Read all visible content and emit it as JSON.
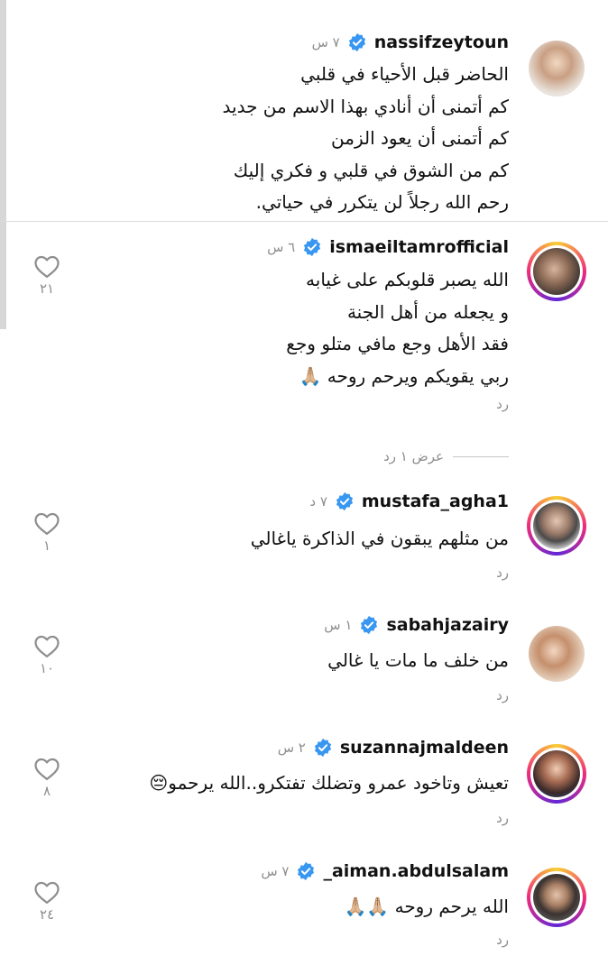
{
  "comments": [
    {
      "username": "nassifzeytoun",
      "time": "٧ س",
      "lines": [
        "الحاضر قبل الأحياء في قلبي",
        "كم أتمنى أن أنادي بهذا الاسم من جديد",
        "كم أتمنى أن يعود الزمن",
        "كم من الشوق في قلبي و فكري إليك",
        "رحم الله رجلاً لن يتكرر في حياتي."
      ],
      "likes": "",
      "reply": ""
    },
    {
      "username": "ismaeiltamrofficial",
      "time": "٦ س",
      "lines": [
        "الله يصبر قلوبكم على غيابه",
        "و يجعله من أهل الجنة",
        "فقد الأهل وجع مافي متلو وجع",
        "ربي يقويكم ويرحم روحه 🙏🏼"
      ],
      "likes": "٢١",
      "reply": "رد"
    },
    {
      "username": "mustafa_agha1",
      "time": "٧ د",
      "lines": [
        "من مثلهم يبقون في الذاكرة ياغالي"
      ],
      "likes": "١",
      "reply": "رد"
    },
    {
      "username": "sabahjazairy",
      "time": "١ س",
      "lines": [
        "من خلف ما مات يا غالي"
      ],
      "likes": "١٠",
      "reply": "رد"
    },
    {
      "username": "suzannajmaldeen",
      "time": "٢ س",
      "lines": [
        "تعيش وتاخود عمرو وتضلك تفتكرو..الله يرحمو😔"
      ],
      "likes": "٨",
      "reply": "رد"
    },
    {
      "username": "_aiman.abdulsalam",
      "time": "٧ س",
      "lines": [
        "الله يرحم روحه 🙏🏼🙏🏼"
      ],
      "likes": "٢٤",
      "reply": "رد"
    }
  ],
  "view_replies": "عرض ١ رد",
  "colors": {
    "verified": "#3897f0",
    "muted": "#8e8e8e",
    "ring_start": "#f9ce34",
    "ring_mid": "#ee2a7b",
    "ring_end": "#6228d7"
  },
  "icons": {
    "like": "heart-outline-icon",
    "verified": "verified-badge-icon"
  }
}
